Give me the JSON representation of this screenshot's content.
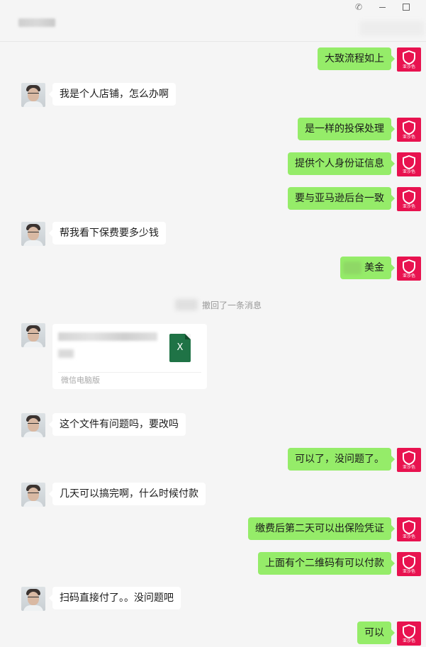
{
  "window": {
    "title_hidden": true,
    "controls": [
      "pin-icon",
      "minimize-icon",
      "maximize-icon"
    ]
  },
  "brand_label": "亚沙色",
  "colors": {
    "background": "#f5f5f5",
    "incoming_bubble": "#ffffff",
    "outgoing_bubble": "#95ec69",
    "brand_avatar": "#e8124f",
    "excel_green": "#1f7346"
  },
  "messages": [
    {
      "dir": "out",
      "text": "大致流程如上"
    },
    {
      "dir": "in",
      "text": "我是个人店铺，怎么办啊"
    },
    {
      "dir": "out",
      "text": "是一样的投保处理"
    },
    {
      "dir": "out",
      "text": "提供个人身份证信息"
    },
    {
      "dir": "out",
      "text": "要与亚马逊后台一致"
    },
    {
      "dir": "in",
      "text": "帮我看下保费要多少钱"
    },
    {
      "dir": "out",
      "text": "美金"
    },
    {
      "dir": "in",
      "text": "这个文件有问题吗，要改吗"
    },
    {
      "dir": "out",
      "text": "可以了，没问题了。"
    },
    {
      "dir": "in",
      "text": "几天可以搞完啊，什么时候付款"
    },
    {
      "dir": "out",
      "text": "缴费后第二天可以出保险凭证"
    },
    {
      "dir": "out",
      "text": "上面有个二维码有可以付款"
    },
    {
      "dir": "in",
      "text": "扫码直接付了。。没问题吧"
    },
    {
      "dir": "out",
      "text": "可以"
    }
  ],
  "system_notice": "撤回了一条消息",
  "file_message": {
    "icon_letter": "X",
    "source": "微信电脑版"
  }
}
